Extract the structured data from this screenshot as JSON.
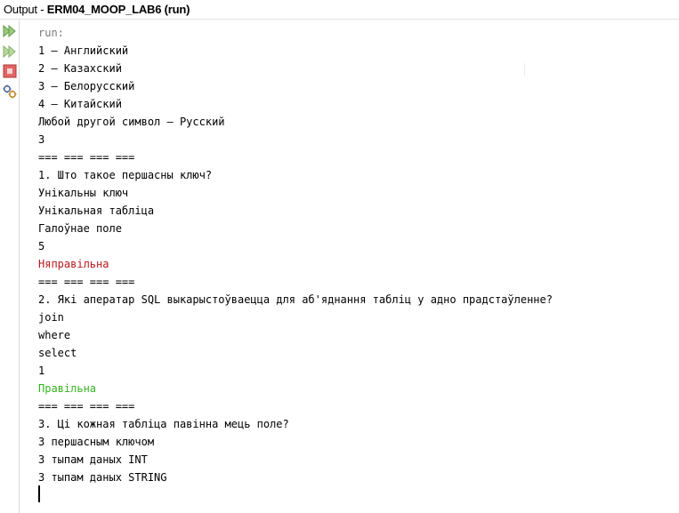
{
  "window": {
    "title_prefix": "Output - ",
    "title_project": "ERM04_MOOP_LAB6 (run)"
  },
  "toolbar": {
    "icons": [
      "rerun-icon",
      "rerun-with-args-icon",
      "stop-icon",
      "settings-icon"
    ],
    "colors": {
      "rerun": "#7ebc5e",
      "stop": "#d9534f",
      "settings": "#5e7fb0"
    }
  },
  "console": {
    "lines": [
      {
        "text": "run:",
        "style": "run"
      },
      {
        "text": "1 – Английский",
        "style": "normal"
      },
      {
        "text": "2 – Казахский",
        "style": "normal"
      },
      {
        "text": "3 – Белорусский",
        "style": "normal"
      },
      {
        "text": "4 – Китайский",
        "style": "normal"
      },
      {
        "text": "Любой другой символ – Русский",
        "style": "normal"
      },
      {
        "text": "3",
        "style": "normal"
      },
      {
        "text": "=== === === ===",
        "style": "normal"
      },
      {
        "text": "1. Што такое першасны ключ?",
        "style": "normal"
      },
      {
        "text": "Унікальны ключ",
        "style": "normal"
      },
      {
        "text": "Унікальная табліца",
        "style": "normal"
      },
      {
        "text": "Галоўнае поле",
        "style": "normal"
      },
      {
        "text": "5",
        "style": "normal"
      },
      {
        "text": "Няправільна",
        "style": "wrong"
      },
      {
        "text": "=== === === ===",
        "style": "normal"
      },
      {
        "text": "2. Які аператар SQL выкарыстоўваецца для аб'яднання табліц у адно прадстаўленне?",
        "style": "normal"
      },
      {
        "text": "join",
        "style": "normal"
      },
      {
        "text": "where",
        "style": "normal"
      },
      {
        "text": "select",
        "style": "normal"
      },
      {
        "text": "1",
        "style": "normal"
      },
      {
        "text": "Правільна",
        "style": "right"
      },
      {
        "text": "=== === === ===",
        "style": "normal"
      },
      {
        "text": "3. Ці кожная табліца павінна мець поле?",
        "style": "normal"
      },
      {
        "text": "З першасным ключом",
        "style": "normal"
      },
      {
        "text": "З тыпам даных INT",
        "style": "normal"
      },
      {
        "text": "З тыпам даных STRING",
        "style": "normal"
      }
    ],
    "colors": {
      "run": "#7a7a7a",
      "wrong": "#b8181c",
      "right": "#35b51f",
      "normal": "#000000"
    }
  }
}
